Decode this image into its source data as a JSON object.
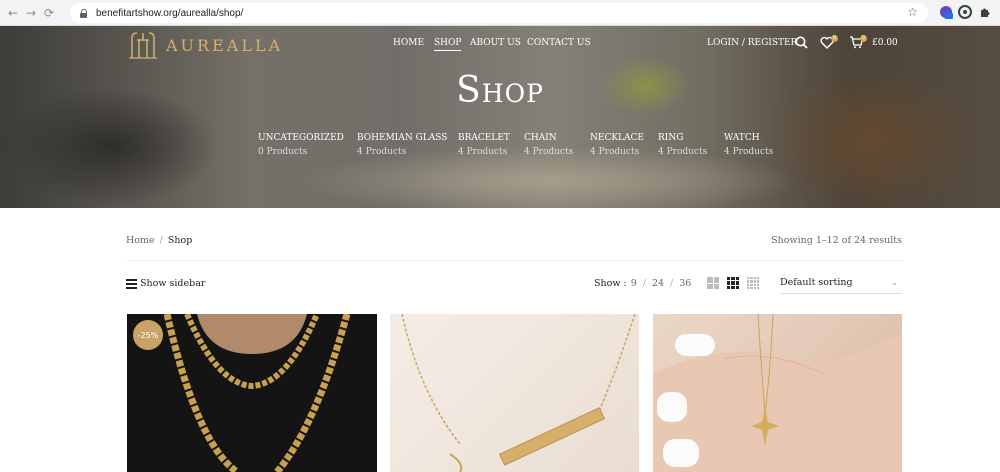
{
  "browser": {
    "url": "benefitartshow.org/aurealla/shop/"
  },
  "header": {
    "logo_text": "AUREALLA",
    "nav": [
      {
        "label": "HOME"
      },
      {
        "label": "SHOP"
      },
      {
        "label": "ABOUT US"
      },
      {
        "label": "CONTACT US"
      }
    ],
    "login_label": "LOGIN / REGISTER",
    "wishlist_count": "0",
    "cart_count": "0",
    "cart_total": "£0.00"
  },
  "hero": {
    "title": "Shop",
    "categories": [
      {
        "name": "UNCATEGORIZED",
        "count": "0 Products"
      },
      {
        "name": "BOHEMIAN GLASS",
        "count": "4 Products"
      },
      {
        "name": "BRACELET",
        "count": "4 Products"
      },
      {
        "name": "CHAIN",
        "count": "4 Products"
      },
      {
        "name": "NECKLACE",
        "count": "4 Products"
      },
      {
        "name": "RING",
        "count": "4 Products"
      },
      {
        "name": "WATCH",
        "count": "4 Products"
      }
    ]
  },
  "breadcrumb": {
    "home": "Home",
    "separator": "/",
    "current": "Shop"
  },
  "results_text": "Showing 1–12 of 24 results",
  "toolbar": {
    "sidebar_label": "Show sidebar",
    "show_label": "Show :",
    "show_options": [
      "9",
      "24",
      "36"
    ],
    "sort_label": "Default sorting"
  },
  "products": [
    {
      "badge": "-25%"
    },
    {},
    {}
  ],
  "colors": {
    "accent_gold": "#d4b068",
    "badge": "#c9a26a"
  }
}
